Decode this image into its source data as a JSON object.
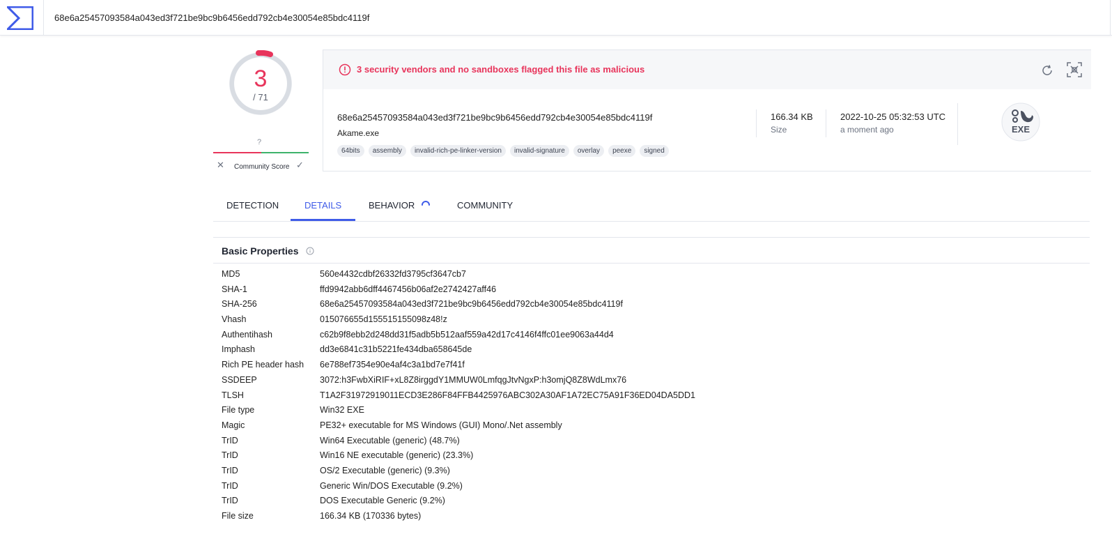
{
  "search": {
    "value": "68e6a25457093584a043ed3f721be9bc9b6456edd792cb4e30054e85bdc4119f"
  },
  "score": {
    "detections": "3",
    "total": "/ 71",
    "unknown_marker": "?",
    "community_label": "Community Score",
    "color_malicious": "#e8345b",
    "color_harmless": "#3db36b"
  },
  "summary": {
    "alert": "3 security vendors and no sandboxes flagged this file as malicious",
    "hash": "68e6a25457093584a043ed3f721be9bc9b6456edd792cb4e30054e85bdc4119f",
    "filename": "Akame.exe",
    "tags": [
      "64bits",
      "assembly",
      "invalid-rich-pe-linker-version",
      "invalid-signature",
      "overlay",
      "peexe",
      "signed"
    ],
    "size_value": "166.34 KB",
    "size_label": "Size",
    "date_value": "2022-10-25 05:32:53 UTC",
    "date_label": "a moment ago",
    "filetype_badge": "EXE"
  },
  "tabs": [
    {
      "label": "DETECTION",
      "active": false
    },
    {
      "label": "DETAILS",
      "active": true
    },
    {
      "label": "BEHAVIOR",
      "active": false
    },
    {
      "label": "COMMUNITY",
      "active": false
    }
  ],
  "basic_properties": {
    "title": "Basic Properties",
    "rows": [
      {
        "key": "MD5",
        "value": "560e4432cdbf26332fd3795cf3647cb7"
      },
      {
        "key": "SHA-1",
        "value": "ffd9942abb6dff4467456b06af2e2742427aff46"
      },
      {
        "key": "SHA-256",
        "value": "68e6a25457093584a043ed3f721be9bc9b6456edd792cb4e30054e85bdc4119f"
      },
      {
        "key": "Vhash",
        "value": "015076655d155515155098z48!z"
      },
      {
        "key": "Authentihash",
        "value": "c62b9f8ebb2d248dd31f5adb5b512aaf559a42d17c4146f4ffc01ee9063a44d4"
      },
      {
        "key": "Imphash",
        "value": "dd3e6841c31b5221fe434dba658645de"
      },
      {
        "key": "Rich PE header hash",
        "value": "6e788ef7354e90e4af4c3a1bd7e7f41f"
      },
      {
        "key": "SSDEEP",
        "value": "3072:h3FwbXiRIF+xL8Z8irggdY1MMUW0LmfqgJtvNgxP:h3omjQ8Z8WdLmx76"
      },
      {
        "key": "TLSH",
        "value": "T1A2F31972919011ECD3E286F84FFB4425976ABC302A30AF1A72EC75A91F36ED04DA5DD1"
      },
      {
        "key": "File type",
        "value": "Win32 EXE"
      },
      {
        "key": "Magic",
        "value": "PE32+ executable for MS Windows (GUI) Mono/.Net assembly"
      },
      {
        "key": "TrID",
        "value": "Win64 Executable (generic) (48.7%)"
      },
      {
        "key": "TrID",
        "value": "Win16 NE executable (generic) (23.3%)"
      },
      {
        "key": "TrID",
        "value": "OS/2 Executable (generic) (9.3%)"
      },
      {
        "key": "TrID",
        "value": "Generic Win/DOS Executable (9.2%)"
      },
      {
        "key": "TrID",
        "value": "DOS Executable Generic (9.2%)"
      },
      {
        "key": "File size",
        "value": "166.34 KB (170336 bytes)"
      }
    ]
  }
}
